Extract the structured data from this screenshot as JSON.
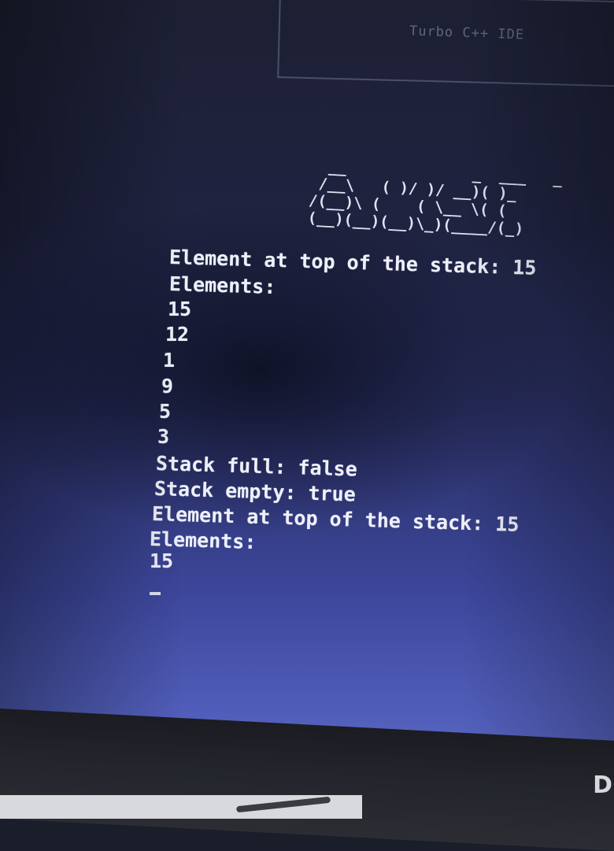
{
  "window": {
    "title": "Turbo C++ IDE"
  },
  "ascii_art": [
    "  __              _  ___   _",
    " /__\\   ( )/ )/ __)( )_",
    "/(__)\\ (    ( \\__ \\( (",
    "(__)(__)(__)\\_)(____/(_)"
  ],
  "console": {
    "lines": [
      "Element at top of the stack: 15",
      "Elements:",
      "15",
      "12",
      "1",
      "9",
      "5",
      "3",
      "Stack full: false",
      "Stack empty: true",
      "Element at top of the stack: 15",
      "Elements:",
      "15"
    ]
  },
  "monitor": {
    "brand_mark": "D"
  }
}
